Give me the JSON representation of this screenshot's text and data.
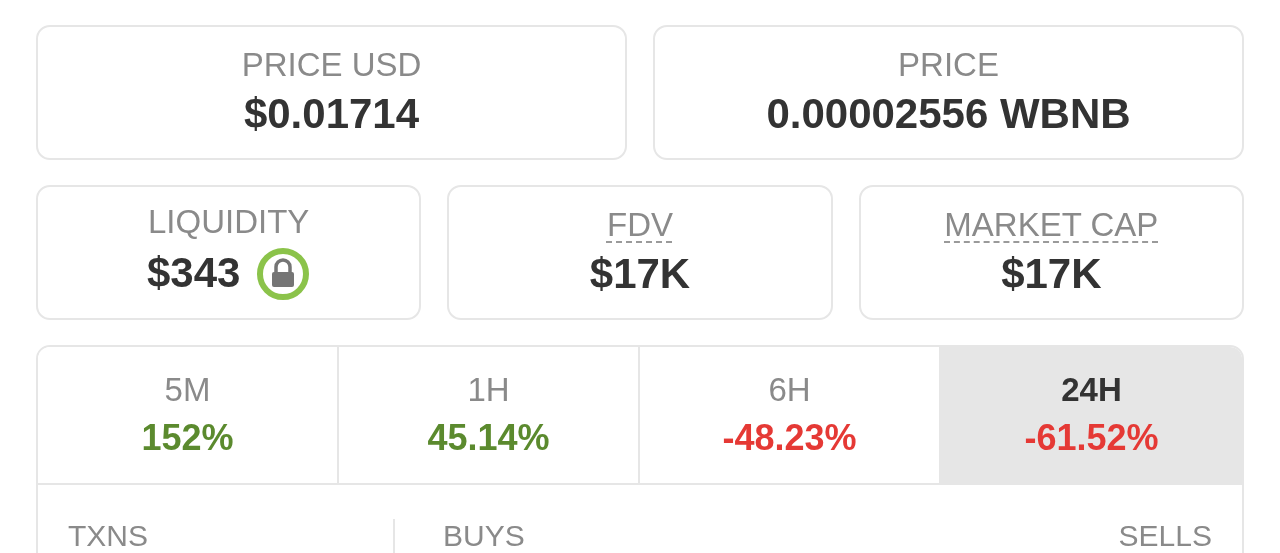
{
  "price_cards": [
    {
      "label": "PRICE USD",
      "value": "$0.01714"
    },
    {
      "label": "PRICE",
      "value": "0.00002556 WBNB"
    }
  ],
  "stat_cards": [
    {
      "label": "LIQUIDITY",
      "value": "$343",
      "locked": true,
      "hint_underline": false
    },
    {
      "label": "FDV",
      "value": "$17K",
      "locked": false,
      "hint_underline": true
    },
    {
      "label": "MARKET CAP",
      "value": "$17K",
      "locked": false,
      "hint_underline": true
    }
  ],
  "timeframes": [
    {
      "label": "5M",
      "change": "152%",
      "color": "#5b8a2e",
      "selected": false
    },
    {
      "label": "1H",
      "change": "45.14%",
      "color": "#5b8a2e",
      "selected": false
    },
    {
      "label": "6H",
      "change": "-48.23%",
      "color": "#e53935",
      "selected": false
    },
    {
      "label": "24H",
      "change": "-61.52%",
      "color": "#e53935",
      "selected": true
    }
  ],
  "txns": {
    "label": "TXNS",
    "buys_label": "BUYS",
    "sells_label": "SELLS"
  }
}
